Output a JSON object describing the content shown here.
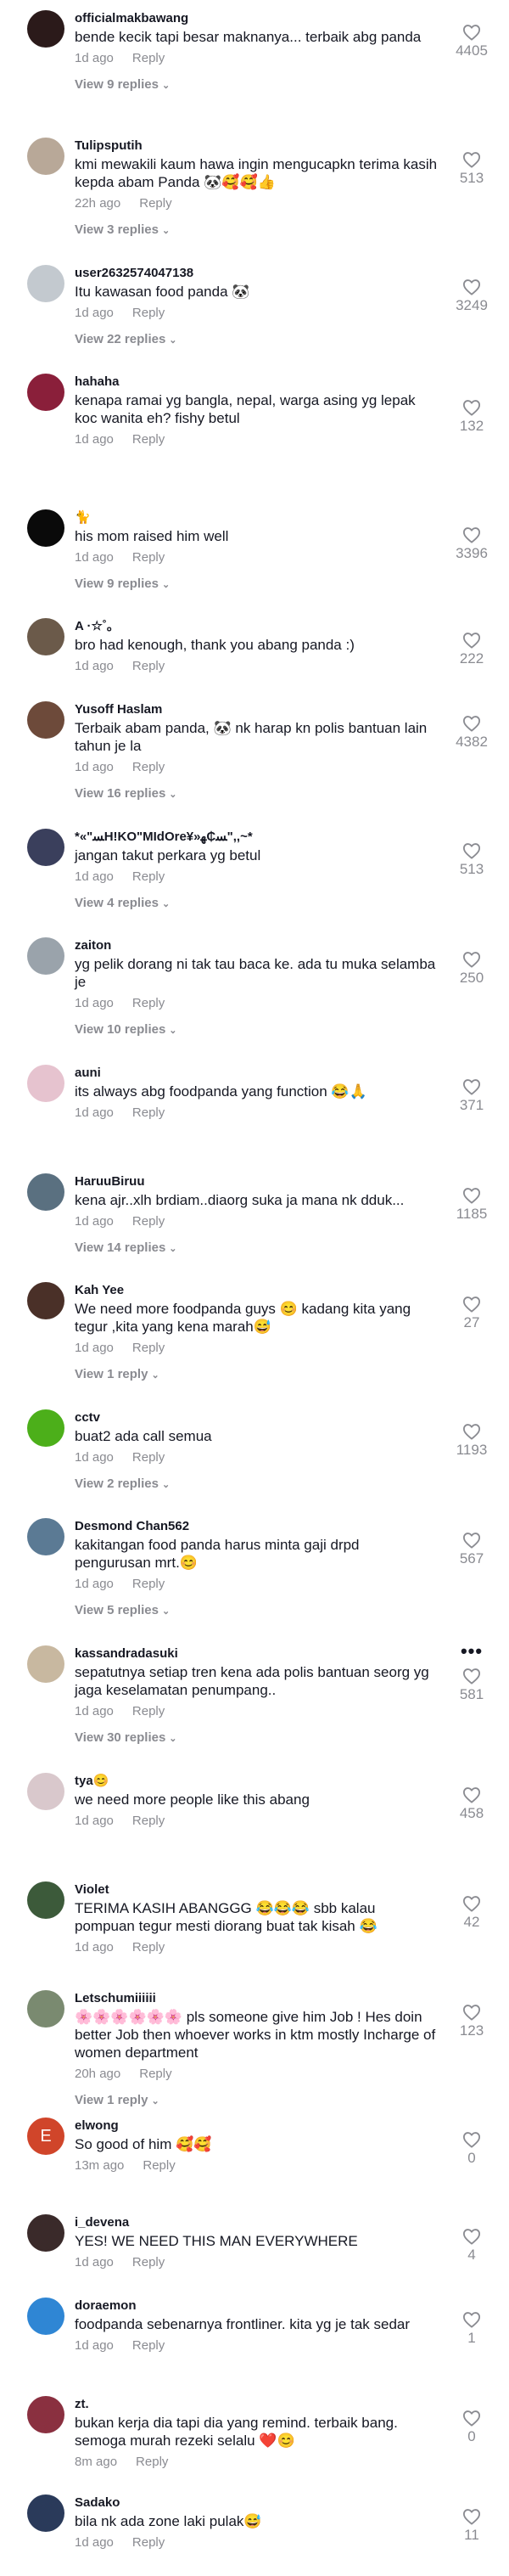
{
  "comments": [
    {
      "user": "officialmakbawang",
      "text": "bende kecik tapi besar maknanya... terbaik abg panda",
      "time": "1d ago",
      "reply": "Reply",
      "replies": "View 9 replies",
      "likes": "4405",
      "avatar_color": "#2b1a1a"
    },
    {
      "user": "Tulipsputih",
      "text": "kmi mewakili kaum hawa ingin mengucapkn terima kasih kepda abam Panda 🐼🥰🥰👍",
      "time": "22h ago",
      "reply": "Reply",
      "replies": "View 3 replies",
      "likes": "513",
      "avatar_color": "#b8a898"
    },
    {
      "user": "user2632574047138",
      "text": "Itu kawasan food panda 🐼",
      "time": "1d ago",
      "reply": "Reply",
      "replies": "View 22 replies",
      "likes": "3249",
      "avatar_color": "#c3c9cf"
    },
    {
      "user": "hahaha",
      "text": "kenapa ramai yg bangla, nepal, warga asing yg lepak koc wanita eh? fishy betul",
      "time": "1d ago",
      "reply": "Reply",
      "replies": "",
      "likes": "132",
      "avatar_color": "#8a1f3a"
    },
    {
      "user": "🐈",
      "text": "his mom raised him well",
      "time": "1d ago",
      "reply": "Reply",
      "replies": "View 9 replies",
      "likes": "3396",
      "avatar_color": "#0a0a0a"
    },
    {
      "user": "A ·☆˚｡",
      "text": "bro had kenough, thank you abang panda :)",
      "time": "1d ago",
      "reply": "Reply",
      "replies": "",
      "likes": "222",
      "avatar_color": "#6b5a4a"
    },
    {
      "user": "Yusoff Haslam",
      "text": "Terbaik abam panda, 🐼 nk harap kn polis bantuan lain tahun je la",
      "time": "1d ago",
      "reply": "Reply",
      "replies": "View 16 replies",
      "likes": "4382",
      "avatar_color": "#6d4a3a"
    },
    {
      "user": "*«\"ﺴH!KO\"MIdOre¥»ﺴ₵ﻬ\",,~*",
      "text": "jangan takut perkara yg betul",
      "time": "1d ago",
      "reply": "Reply",
      "replies": "View 4 replies",
      "likes": "513",
      "avatar_color": "#3a3f5c"
    },
    {
      "user": "zaiton",
      "text": "yg pelik dorang ni tak tau baca ke. ada tu muka selamba je",
      "time": "1d ago",
      "reply": "Reply",
      "replies": "View 10 replies",
      "likes": "250",
      "avatar_color": "#9aa3ab"
    },
    {
      "user": "auni",
      "text": "its always abg foodpanda yang function 😂🙏",
      "time": "1d ago",
      "reply": "Reply",
      "replies": "",
      "likes": "371",
      "avatar_color": "#e6c3cf"
    },
    {
      "user": "HaruuBiruu",
      "text": "kena ajr..xlh brdiam..diaorg suka ja mana nk dduk...",
      "time": "1d ago",
      "reply": "Reply",
      "replies": "View 14 replies",
      "likes": "1185",
      "avatar_color": "#5a7080"
    },
    {
      "user": "Kah Yee",
      "text": "We need more foodpanda guys 😊 kadang kita yang tegur ,kita yang kena marah😅",
      "time": "1d ago",
      "reply": "Reply",
      "replies": "View 1 reply",
      "likes": "27",
      "avatar_color": "#4a3028"
    },
    {
      "user": "cctv",
      "text": "buat2 ada call semua",
      "time": "1d ago",
      "reply": "Reply",
      "replies": "View 2 replies",
      "likes": "1193",
      "avatar_color": "#4caf1a"
    },
    {
      "user": "Desmond Chan562",
      "text": "kakitangan food panda harus minta gaji drpd pengurusan mrt.😊",
      "time": "1d ago",
      "reply": "Reply",
      "replies": "View 5 replies",
      "likes": "567",
      "avatar_color": "#5b7a94"
    },
    {
      "user": "kassandradasuki",
      "text": "sepatutnya setiap tren kena ada polis bantuan seorg yg jaga keselamatan penumpang..",
      "time": "1d ago",
      "reply": "Reply",
      "replies": "View 30 replies",
      "likes": "581",
      "avatar_color": "#c8b8a0"
    },
    {
      "user": "tya😊",
      "text": "we need more people like this abang",
      "time": "1d ago",
      "reply": "Reply",
      "replies": "",
      "likes": "458",
      "avatar_color": "#d9c8cc"
    },
    {
      "user": "Violet",
      "text": "TERIMA KASIH ABANGGG 😂😂😂 sbb kalau pompuan tegur mesti diorang buat tak kisah 😂",
      "time": "1d ago",
      "reply": "Reply",
      "replies": "",
      "likes": "42",
      "avatar_color": "#3c5a3a"
    },
    {
      "user": "Letschumiiiiii",
      "text": "🌸🌸🌸🌸🌸🌸 pls someone give him Job ! Hes doin better Job then whoever works in ktm mostly Incharge of women department",
      "time": "20h ago",
      "reply": "Reply",
      "replies": "View 1 reply",
      "likes": "123",
      "avatar_color": "#7a8a70"
    },
    {
      "user": "elwong",
      "text": "So good of him 🥰🥰",
      "time": "13m ago",
      "reply": "Reply",
      "replies": "",
      "likes": "0",
      "avatar_color": "#d0452a",
      "avatar_letter": "E"
    },
    {
      "user": "i_devena",
      "text": "YES! WE NEED THIS MAN EVERYWHERE",
      "time": "1d ago",
      "reply": "Reply",
      "replies": "",
      "likes": "4",
      "avatar_color": "#3a2a2a"
    },
    {
      "user": "doraemon",
      "text": "foodpanda sebenarnya frontliner. kita yg je tak sedar",
      "time": "1d ago",
      "reply": "Reply",
      "replies": "",
      "likes": "1",
      "avatar_color": "#2f86d4"
    },
    {
      "user": "zt.",
      "text": "bukan kerja dia tapi dia yang remind. terbaik bang. semoga murah rezeki selalu ❤️😊",
      "time": "8m ago",
      "reply": "Reply",
      "replies": "",
      "likes": "0",
      "avatar_color": "#8a3040"
    },
    {
      "user": "Sadako",
      "text": "bila nk ada zone laki pulak😅",
      "time": "1d ago",
      "reply": "Reply",
      "replies": "",
      "likes": "11",
      "avatar_color": "#2a3a5a"
    }
  ],
  "more_label": "•••"
}
